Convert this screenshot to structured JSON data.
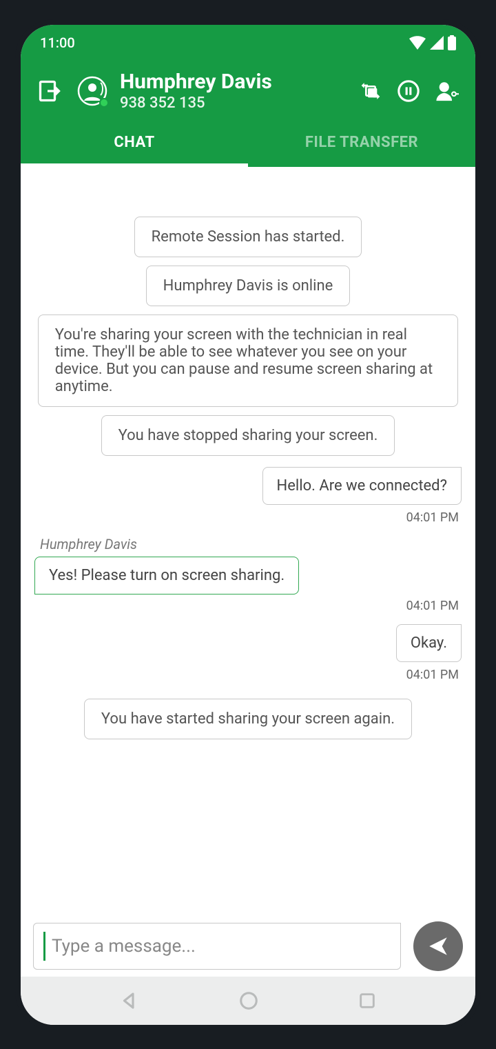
{
  "status_bar": {
    "time": "11:00"
  },
  "header": {
    "name": "Humphrey Davis",
    "session_id": "938 352 135"
  },
  "tabs": {
    "chat": "CHAT",
    "file_transfer": "FILE TRANSFER"
  },
  "messages": {
    "sys1": "Remote Session has started.",
    "sys2": "Humphrey Davis is online",
    "sys3": "You're sharing your screen with the technician in real time. They'll be able to see whatever you see on your device. But you can pause and resume screen sharing at anytime.",
    "sys4": "You have stopped sharing your screen.",
    "out1": {
      "text": "Hello. Are we connected?",
      "time": "04:01 PM"
    },
    "in1": {
      "sender": "Humphrey Davis",
      "text": "Yes! Please turn on screen sharing.",
      "time": "04:01 PM"
    },
    "out2": {
      "text": "Okay.",
      "time": "04:01 PM"
    },
    "sys5": "You have started sharing your screen again."
  },
  "input": {
    "placeholder": "Type a message..."
  }
}
